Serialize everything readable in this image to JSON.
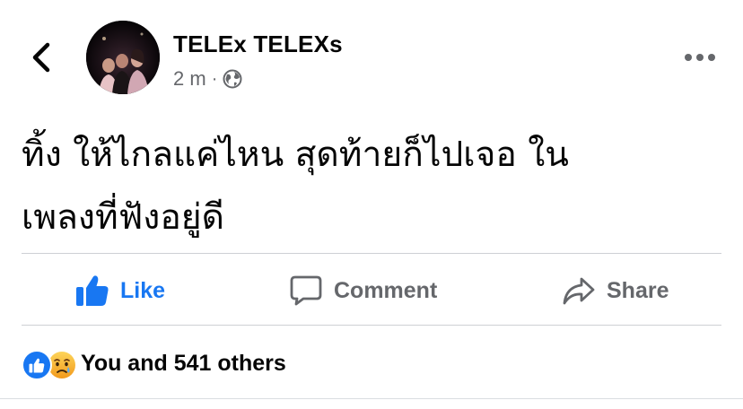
{
  "post": {
    "author_name": "TELEx TELEXs",
    "timestamp": "2 m",
    "separator": "·",
    "privacy_icon": "globe-icon",
    "text": "ทิ้ง ให้ไกลแค่ไหน สุดท้ายก็ไปเจอ ใน\nเพลงที่ฟังอยู่ดี"
  },
  "header": {
    "back_icon": "chevron-left-icon",
    "more_icon": "more-horizontal-icon"
  },
  "actions": {
    "like_label": "Like",
    "comment_label": "Comment",
    "share_label": "Share"
  },
  "reactions": {
    "icons": [
      "like-reaction-icon",
      "sad-reaction-icon"
    ],
    "summary": "You and 541 others"
  },
  "colors": {
    "accent": "#1877f2",
    "secondary_text": "#65676b",
    "divider": "#ced0d4",
    "text": "#050505",
    "sad_face": "#f7b125"
  }
}
